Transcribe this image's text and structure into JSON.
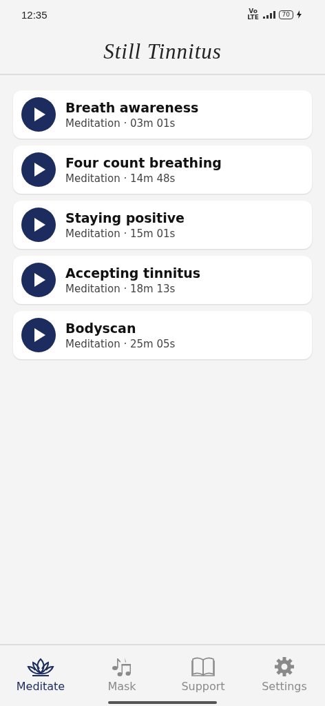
{
  "status_bar": {
    "time": "12:35",
    "network": "Vo LTE",
    "battery": "70"
  },
  "header": {
    "title": "Still Tinnitus"
  },
  "sessions": [
    {
      "title": "Breath awareness",
      "subtitle": "Meditation · 03m 01s"
    },
    {
      "title": "Four count breathing",
      "subtitle": "Meditation · 14m 48s"
    },
    {
      "title": "Staying positive",
      "subtitle": "Meditation · 15m 01s"
    },
    {
      "title": "Accepting tinnitus",
      "subtitle": "Meditation · 18m 13s"
    },
    {
      "title": "Bodyscan",
      "subtitle": "Meditation · 25m 05s"
    }
  ],
  "nav": [
    {
      "kind": "lotus",
      "label": "Meditate",
      "selected": true
    },
    {
      "kind": "music",
      "label": "Mask",
      "selected": false
    },
    {
      "kind": "book",
      "label": "Support",
      "selected": false
    },
    {
      "kind": "gear",
      "label": "Settings",
      "selected": false
    }
  ]
}
